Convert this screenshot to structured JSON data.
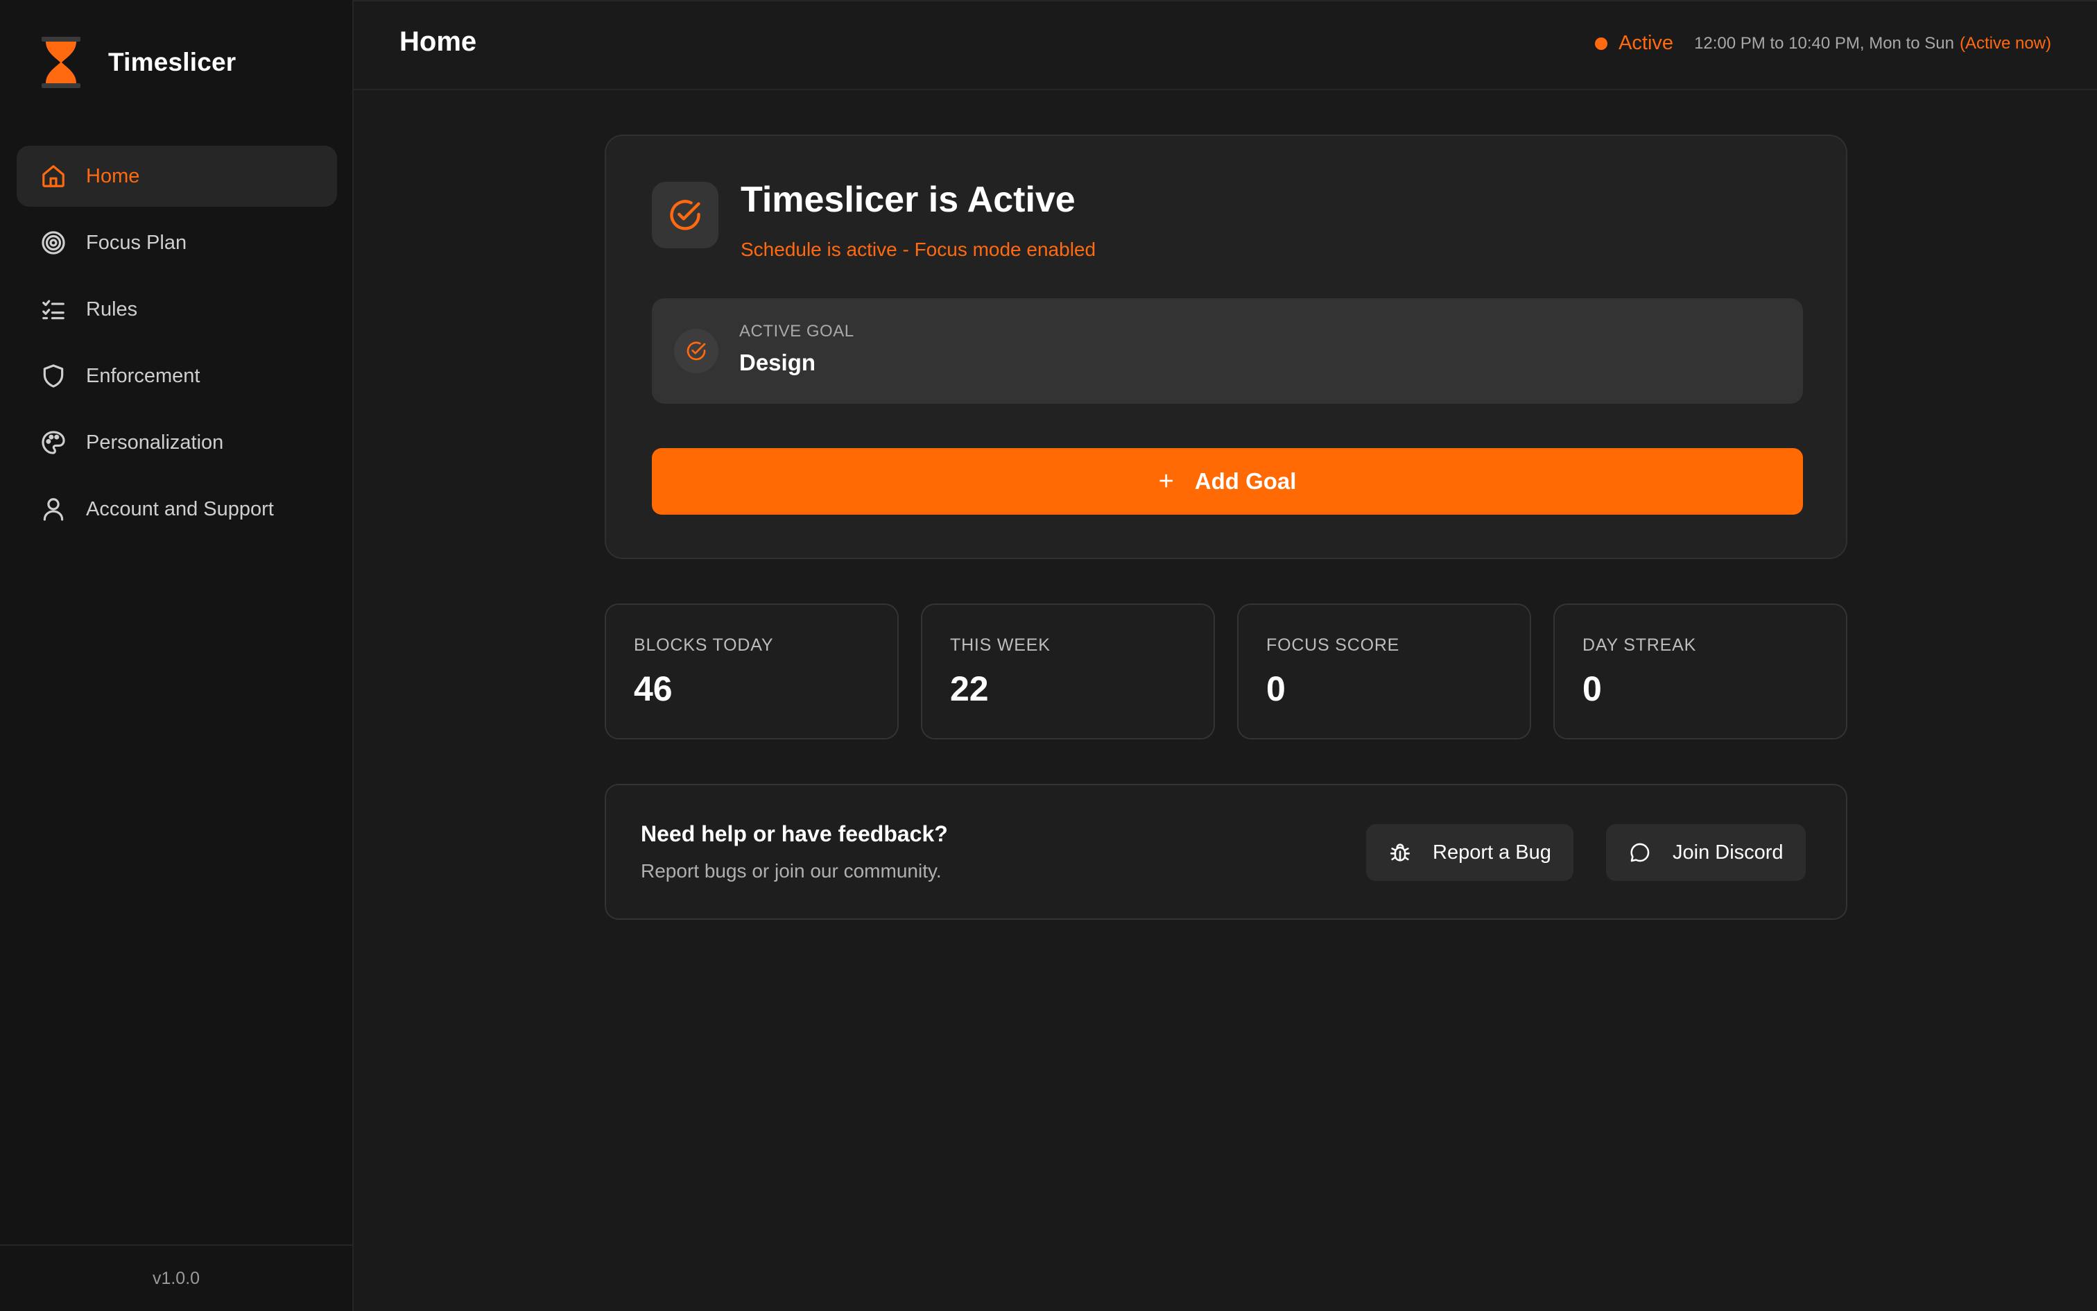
{
  "app": {
    "name": "Timeslicer",
    "version": "v1.0.0"
  },
  "sidebar": {
    "items": [
      {
        "label": "Home",
        "icon": "home-icon",
        "active": true
      },
      {
        "label": "Focus Plan",
        "icon": "target-icon"
      },
      {
        "label": "Rules",
        "icon": "checklist-icon"
      },
      {
        "label": "Enforcement",
        "icon": "shield-icon"
      },
      {
        "label": "Personalization",
        "icon": "palette-icon"
      },
      {
        "label": "Account and Support",
        "icon": "user-icon"
      }
    ]
  },
  "header": {
    "title": "Home",
    "status": "Active",
    "schedule": "12:00 PM to 10:40 PM, Mon to Sun",
    "schedule_now": "(Active now)"
  },
  "hero": {
    "title": "Timeslicer is Active",
    "subtitle": "Schedule is active - Focus mode enabled",
    "goal_label": "ACTIVE GOAL",
    "goal_value": "Design",
    "add_goal_label": "Add Goal"
  },
  "stats": [
    {
      "label": "BLOCKS TODAY",
      "value": "46"
    },
    {
      "label": "THIS WEEK",
      "value": "22"
    },
    {
      "label": "FOCUS SCORE",
      "value": "0"
    },
    {
      "label": "DAY STREAK",
      "value": "0"
    }
  ],
  "help": {
    "title": "Need help or have feedback?",
    "subtitle": "Report bugs or join our community.",
    "report_label": "Report a Bug",
    "discord_label": "Join Discord"
  },
  "colors": {
    "accent": "#ff6a10",
    "background": "#1a1a1a",
    "sidebar": "#141414"
  }
}
